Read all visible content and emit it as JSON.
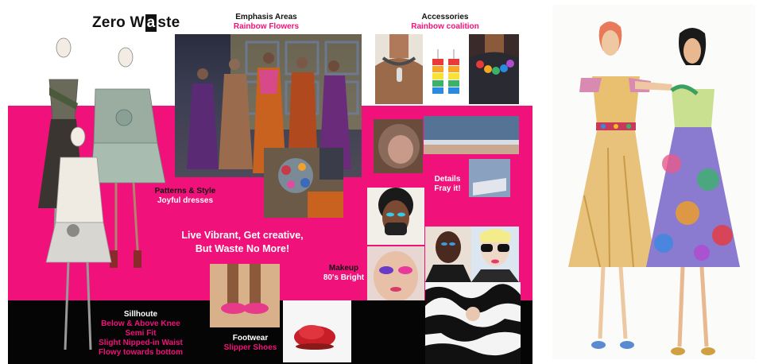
{
  "title": {
    "before": "Zero W",
    "boxed": "a",
    "after": "ste"
  },
  "emphasis": {
    "heading": "Emphasis Areas",
    "sub": "Rainbow Flowers"
  },
  "accessories": {
    "heading": "Accessories",
    "sub": "Rainbow coalition"
  },
  "patterns": {
    "heading": "Patterns & Style",
    "sub": "Joyful dresses"
  },
  "details": {
    "heading": "Details",
    "sub": "Fray it!"
  },
  "makeup": {
    "heading": "Makeup",
    "sub": "80's Bright"
  },
  "slogan": {
    "line1": "Live Vibrant, Get creative,",
    "line2": "But Waste No More!"
  },
  "silhouette": {
    "heading": "Sillhoute",
    "lines": [
      "Below & Above Knee",
      "Semi Fit",
      "Slight Nipped-in Waist",
      "Flowy towards bottom"
    ]
  },
  "footwear": {
    "heading": "Footwear",
    "sub": "Slipper Shoes"
  },
  "colors": {
    "pink": "#f0127a",
    "black": "#050505"
  }
}
